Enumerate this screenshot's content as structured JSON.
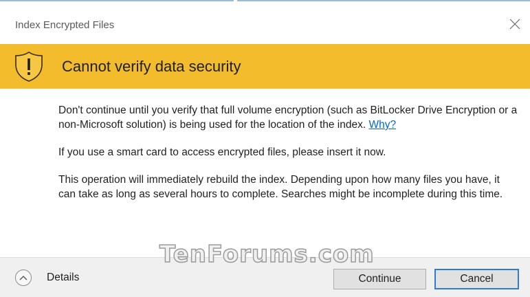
{
  "window": {
    "title": "Index Encrypted Files",
    "close_icon": "close-icon"
  },
  "banner": {
    "icon": "warning-shield-icon",
    "text": "Cannot verify data security",
    "color": "#f3bc2c"
  },
  "body": {
    "paragraph1": "Don't continue until you verify that full volume encryption (such as BitLocker Drive Encryption or a non-Microsoft solution) is being used for the location of the index.",
    "why_link": "Why?",
    "paragraph2": "If you use a smart card to access encrypted files, please insert it now.",
    "paragraph3": "This operation will immediately rebuild the index. Depending upon how many files you have, it can take as long as several hours to complete. Searches might be incomplete during this time."
  },
  "watermark": "TenForums.com",
  "footer": {
    "details_label": "Details",
    "details_icon": "chevron-up-icon",
    "continue_label": "Continue",
    "cancel_label": "Cancel",
    "focus_color": "#2d7bd4"
  }
}
